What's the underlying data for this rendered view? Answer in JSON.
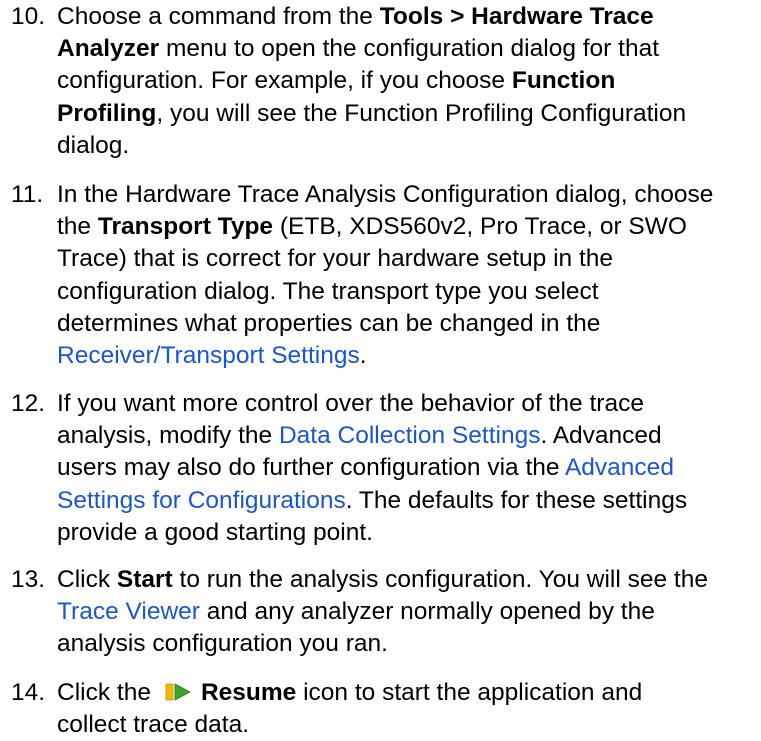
{
  "steps": [
    {
      "number": "10.",
      "lines": [
        [
          "Choose a command from the ",
          {
            "b": "Tools > Hardware Trace"
          }
        ],
        [
          {
            "b": "Analyzer"
          },
          " menu to open the configuration dialog for that"
        ],
        [
          "configuration. For example, if you choose ",
          {
            "b": "Function"
          }
        ],
        [
          {
            "b": "Profiling"
          },
          ", you will see the Function Profiling Configuration"
        ],
        [
          "dialog."
        ]
      ]
    },
    {
      "number": "11.",
      "lines": [
        [
          "In the Hardware Trace Analysis Configuration dialog, choose"
        ],
        [
          "the ",
          {
            "b": "Transport Type"
          },
          " (ETB, XDS560v2, Pro Trace, or SWO"
        ],
        [
          "Trace) that is correct for your hardware setup in the"
        ],
        [
          "configuration dialog. The transport type you select"
        ],
        [
          "determines what properties can be changed in the"
        ],
        [
          {
            "link": "Receiver/Transport Settings"
          },
          "."
        ]
      ]
    },
    {
      "number": "12.",
      "lines": [
        [
          "If you want more control over the behavior of the trace"
        ],
        [
          "analysis, modify the ",
          {
            "link": "Data Collection Settings"
          },
          ". Advanced"
        ],
        [
          "users may also do further configuration via the ",
          {
            "link": "Advanced"
          }
        ],
        [
          {
            "link": "Settings for Configurations"
          },
          ". The defaults for these settings"
        ],
        [
          "provide a good starting point."
        ]
      ]
    },
    {
      "number": "13.",
      "lines": [
        [
          "Click ",
          {
            "b": "Start"
          },
          " to run the analysis configuration. You will see the"
        ],
        [
          {
            "link": "Trace Viewer"
          },
          " and any analyzer normally opened by the"
        ],
        [
          "analysis configuration you ran."
        ]
      ]
    },
    {
      "number": "14.",
      "lines": [
        [
          "Click the",
          {
            "icon": "resume-icon"
          },
          {
            "b": "Resume"
          },
          " icon to start the application and"
        ],
        [
          "collect trace data."
        ]
      ]
    }
  ],
  "colors": {
    "text": "#000000",
    "link": "#1a55d6",
    "resume_icon_bar": "#f2b705",
    "resume_icon_arrow": "#3fa52a"
  }
}
